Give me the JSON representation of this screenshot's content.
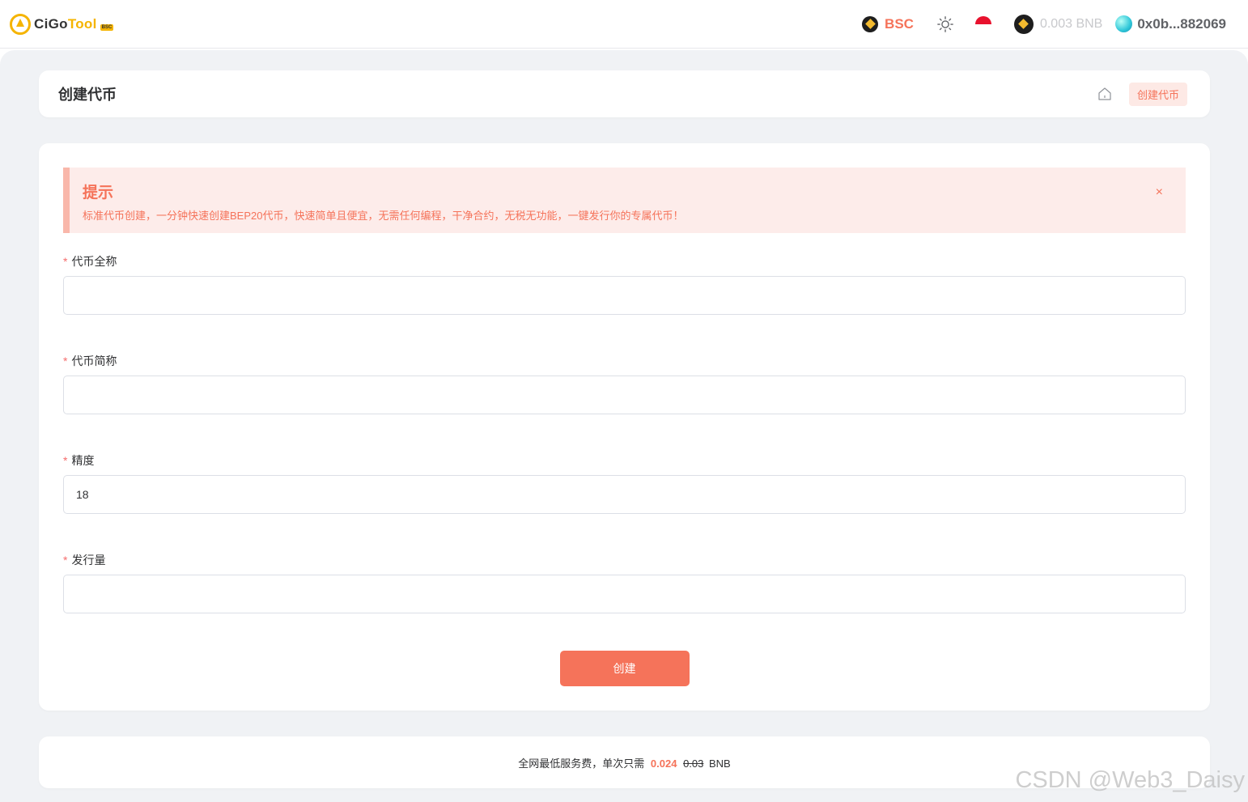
{
  "header": {
    "logo_text_a": "CiGo",
    "logo_text_b": "Tool",
    "logo_badge": "BSC",
    "chain_label": "BSC",
    "balance": "0.003 BNB",
    "wallet": "0x0b...882069"
  },
  "page": {
    "title": "创建代币",
    "breadcrumb_current": "创建代币"
  },
  "alert": {
    "title": "提示",
    "description": "标准代币创建，一分钟快速创建BEP20代币，快速简单且便宜，无需任何编程，干净合约，无税无功能，一键发行你的专属代币！",
    "close": "×"
  },
  "form": {
    "required_mark": "*",
    "name_label": "代币全称",
    "name_value": "",
    "symbol_label": "代币简称",
    "symbol_value": "",
    "decimals_label": "精度",
    "decimals_value": "18",
    "supply_label": "发行量",
    "supply_value": "",
    "submit_label": "创建"
  },
  "fee": {
    "prefix": "全网最低服务费，单次只需",
    "price": "0.024",
    "old_price": "0.03",
    "unit": "BNB"
  },
  "watermark": "CSDN @Web3_Daisy",
  "colors": {
    "accent": "#f5735a",
    "alert_bg": "#fdecea",
    "page_bg": "#f0f2f5"
  }
}
